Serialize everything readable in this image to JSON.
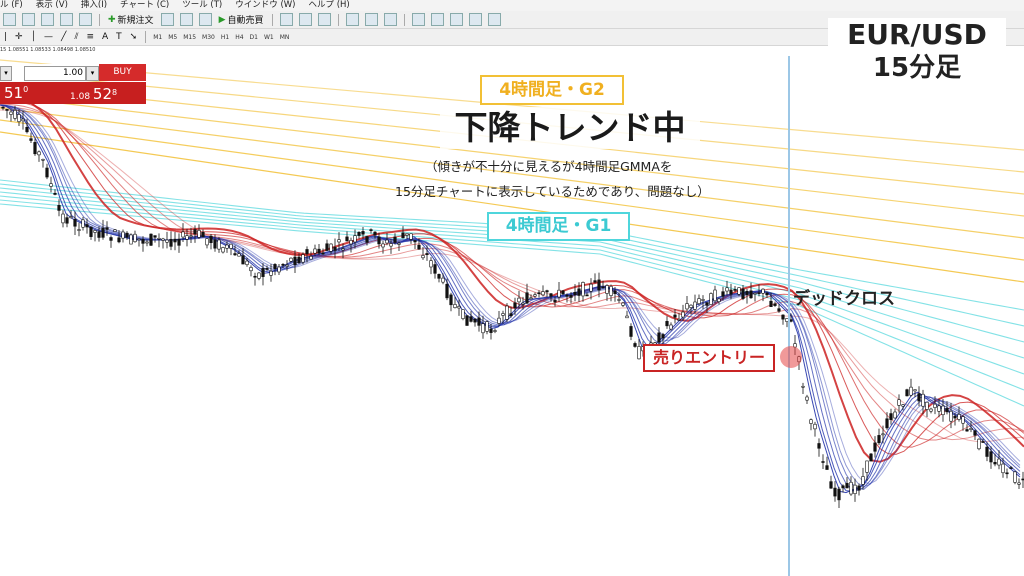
{
  "menu": [
    "ル (F)",
    "表示 (V)",
    "挿入(I)",
    "チャート (C)",
    "ツール (T)",
    "ウインドウ (W)",
    "ヘルプ (H)"
  ],
  "toolbar": {
    "new_order": "新規注文",
    "auto_trade": "自動売買",
    "timeframes": [
      "M1",
      "M5",
      "M15",
      "M30",
      "H1",
      "H4",
      "D1",
      "W1",
      "MN"
    ]
  },
  "quote_line": "15 1.08551 1.08533 1.08498 1.08510",
  "trade_panel": {
    "lot": "1.00",
    "buy_label": "BUY",
    "sell_price_big": "51",
    "sell_price_sup": "0",
    "buy_price_small": "1.08",
    "buy_price_big": "52",
    "buy_price_sup": "8"
  },
  "pair_box": {
    "pair": "EUR/USD",
    "timeframe": "15分足"
  },
  "labels": {
    "g2": "4時間足・G2",
    "g1": "4時間足・G1",
    "headline": "下降トレンド中",
    "note_line1": "（傾きが不十分に見えるが4時間足GMMAを",
    "note_line2": "15分足チャートに表示しているためであり、問題なし）",
    "dead_cross": "デッドクロス",
    "sell_entry": "売りエントリー"
  },
  "colors": {
    "g2_band": "#f2c035",
    "g1_band": "#4fd6dc",
    "short_gmma": "#2233aa",
    "long_gmma": "#cc2222",
    "sell_accent": "#c92424",
    "buy_button": "#d52b2b"
  }
}
